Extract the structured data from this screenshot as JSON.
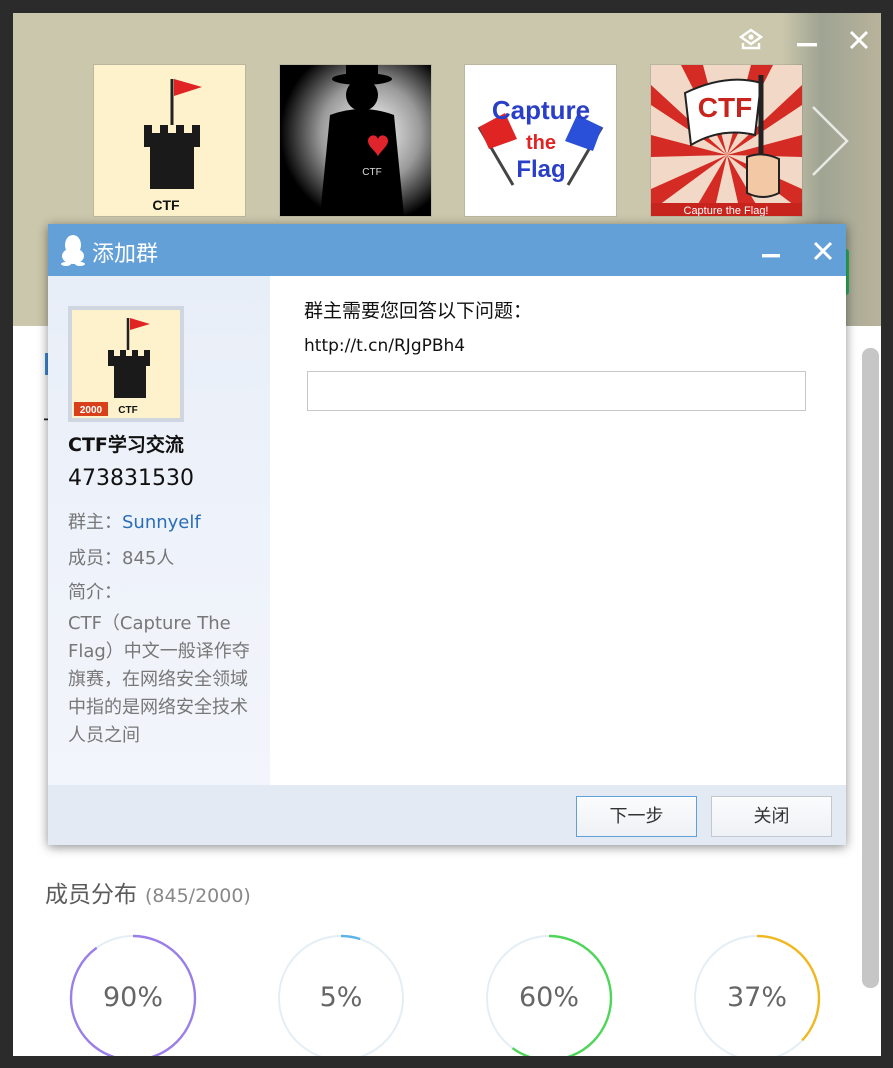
{
  "dialog": {
    "title": "添加群",
    "question_label": "群主需要您回答以下问题：",
    "question_text": "http://t.cn/RJgPBh4",
    "answer_value": "",
    "next_label": "下一步",
    "close_label": "关闭"
  },
  "group": {
    "name": "CTF学习交流",
    "id": "473831530",
    "owner_label": "群主：",
    "owner_name": "Sunnyelf",
    "members_label": "成员：845人",
    "intro_label": "简介：",
    "intro_text": "CTF（Capture The Flag）中文一般译作夺旗赛，在网络安全领域中指的是网络安全技术人员之间",
    "avatar_badge": "2000",
    "avatar_caption": "CTF"
  },
  "banner": {
    "thumbnails": [
      {
        "caption": "CTF"
      },
      {
        "caption": "CTF"
      },
      {
        "line1": "Capture",
        "line2": "the",
        "line3": "Flag"
      },
      {
        "title": "CTF",
        "caption": "Capture the Flag!"
      }
    ]
  },
  "section": {
    "title": "成员分布",
    "count": "(845/2000)"
  },
  "stats": [
    {
      "label": "90%",
      "value": 90,
      "color": "#9b7ee8"
    },
    {
      "label": "5%",
      "value": 5,
      "color": "#5bb4e8"
    },
    {
      "label": "60%",
      "value": 60,
      "color": "#4fd65a"
    },
    {
      "label": "37%",
      "value": 37,
      "color": "#f0b820"
    }
  ],
  "colors": {
    "titlebar": "#64a0d8",
    "banner": "#cbc7ac",
    "owner_link": "#2a6db8",
    "ring_track": "#e4eef5"
  },
  "icons": [
    "settings-icon",
    "minimize-icon",
    "close-icon",
    "next-arrow-icon",
    "qq-penguin-icon"
  ]
}
